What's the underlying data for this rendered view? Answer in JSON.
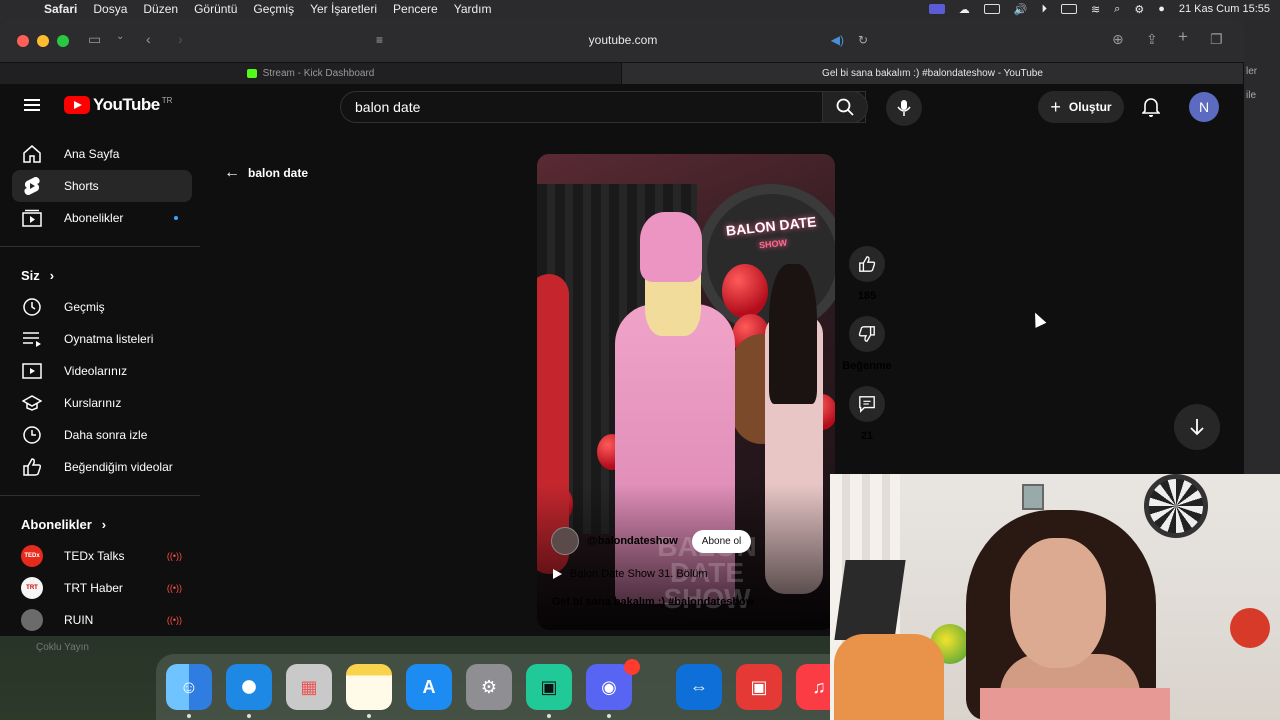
{
  "menubar": {
    "app": "Safari",
    "items": [
      "Dosya",
      "Düzen",
      "Görüntü",
      "Geçmiş",
      "Yer İşaretleri",
      "Pencere",
      "Yardım"
    ],
    "datetime": "21 Kas Cum  15:55"
  },
  "browser": {
    "url": "youtube.com",
    "tabs": [
      {
        "title": "Stream - Kick Dashboard"
      },
      {
        "title": "Gel bi sana bakalım :) #balondateshow - YouTube"
      }
    ],
    "side_text": [
      "ler",
      "ile"
    ]
  },
  "youtube": {
    "logo": "YouTube",
    "country": "TR",
    "search_value": "balon date",
    "create_label": "Oluştur",
    "avatar_letter": "N",
    "back_label": "balon date",
    "sidebar": {
      "main": [
        {
          "label": "Ana Sayfa",
          "icon": "home-icon"
        },
        {
          "label": "Shorts",
          "icon": "shorts-icon"
        },
        {
          "label": "Abonelikler",
          "icon": "subscriptions-icon"
        }
      ],
      "you_header": "Siz",
      "you": [
        {
          "label": "Geçmiş",
          "icon": "history-icon"
        },
        {
          "label": "Oynatma listeleri",
          "icon": "playlists-icon"
        },
        {
          "label": "Videolarınız",
          "icon": "your-videos-icon"
        },
        {
          "label": "Kurslarınız",
          "icon": "courses-icon"
        },
        {
          "label": "Daha sonra izle",
          "icon": "watch-later-icon"
        },
        {
          "label": "Beğendiğim videolar",
          "icon": "liked-icon"
        }
      ],
      "subs_header": "Abonelikler",
      "subs": [
        {
          "label": "TEDx Talks",
          "avatar_text": "TEDx",
          "color": "#e62b1e"
        },
        {
          "label": "TRT Haber",
          "avatar_text": "TRT",
          "color": "#f5f5f5"
        },
        {
          "label": "RUIN",
          "avatar_text": "",
          "color": "#6b6b6b"
        }
      ],
      "more_text": "Çoklu Yayın"
    },
    "short": {
      "channel": "@balondateshow",
      "subscribe": "Abone ol",
      "series": "Balon Date Show 31. Bölüm",
      "title": "Gel bi sana bakalım :) #balondateshow",
      "neon": "BALON DATE",
      "neon_sub": "SHOW",
      "watermark": "BALON DATE SHOW"
    },
    "actions": {
      "likes": "185",
      "dislike_label": "Beğenme",
      "comments": "21"
    }
  },
  "dock": {
    "apps": [
      "finder",
      "safari",
      "launchpad",
      "notes",
      "app-store",
      "settings",
      "facetime",
      "discord",
      "teamviewer",
      "photo-booth",
      "music"
    ]
  },
  "colors": {
    "yt_bg": "#0f0f0f",
    "yt_red": "#ff0000",
    "live_red": "#ff4e45",
    "accent_blue": "#3ea6ff"
  }
}
